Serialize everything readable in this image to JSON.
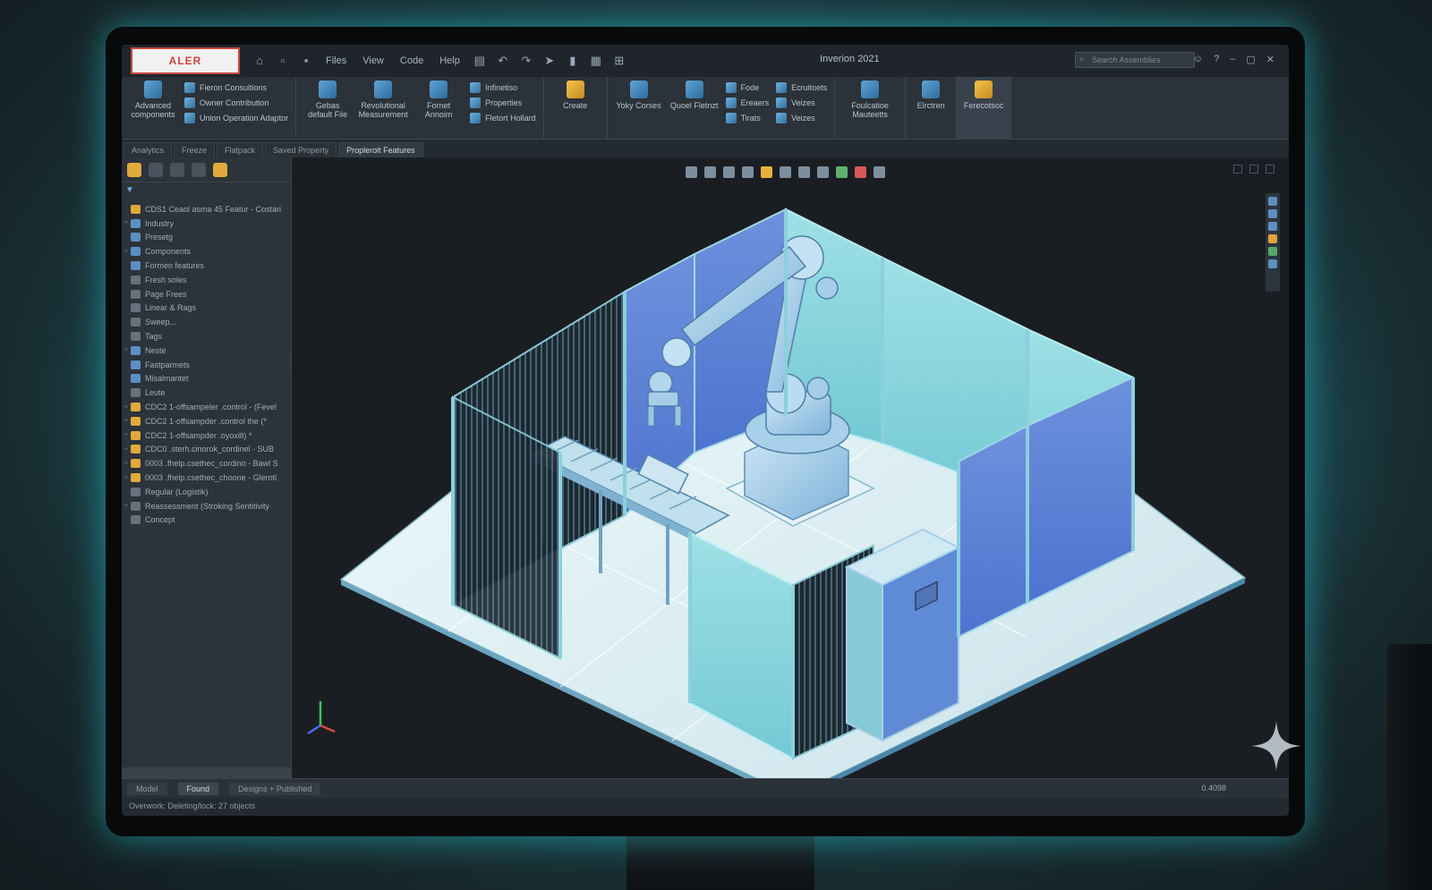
{
  "app": {
    "logo_text": "ALER",
    "window_title": "Inverion 2021",
    "search_placeholder": "Search Assemblies"
  },
  "menu": [
    "Files",
    "View",
    "Code",
    "Help"
  ],
  "ribbon": {
    "group1": [
      {
        "label": "Fieron Consultions"
      },
      {
        "label": "Owner Contribution"
      },
      {
        "label": "Union Operation Adaptor"
      }
    ],
    "group1_big": "Advanced components",
    "group2": [
      {
        "label": "Gebas default File"
      },
      {
        "label": "Revolutional Measurement"
      },
      {
        "label": "Fornet Annoim"
      }
    ],
    "group2_small": [
      "Infinetiso",
      "Properties",
      "Fletort Hollard"
    ],
    "create": "Create",
    "group3_big": [
      "Yoky Corses",
      "Quoel Fletnzt"
    ],
    "group3_small": [
      "Fode",
      "Ereaers",
      "Tirats"
    ],
    "group4_small": [
      "Ecruitoets",
      "Veizes",
      "Veizes"
    ],
    "group5_big": [
      "Foulcatioe Mauteetts",
      "Elrctren",
      "Ferecotsoc"
    ]
  },
  "tabs": [
    "Analytics",
    "Freeze",
    "Flatpack",
    "Saved Property",
    "Proplerolt Features"
  ],
  "active_tab_index": 4,
  "tree": [
    {
      "label": "CDS1 Ceaol asma 45 Featur - Costari",
      "icon": "y",
      "exp": "-"
    },
    {
      "label": "Industry",
      "icon": "b",
      "exp": "+"
    },
    {
      "label": "Presetg",
      "icon": "b",
      "exp": ""
    },
    {
      "label": "Components",
      "icon": "b",
      "exp": "+"
    },
    {
      "label": "Formen features",
      "icon": "b",
      "exp": ""
    },
    {
      "label": "Fresh soles",
      "icon": "g",
      "exp": ""
    },
    {
      "label": "Page Frees",
      "icon": "g",
      "exp": ""
    },
    {
      "label": "Linear & Rags",
      "icon": "g",
      "exp": ""
    },
    {
      "label": "Sweep...",
      "icon": "g",
      "exp": ""
    },
    {
      "label": "Tags",
      "icon": "g",
      "exp": ""
    },
    {
      "label": "Neste",
      "icon": "b",
      "exp": "+"
    },
    {
      "label": "Fastparmets",
      "icon": "b",
      "exp": ""
    },
    {
      "label": "Misalmantet",
      "icon": "b",
      "exp": ""
    },
    {
      "label": "Leute",
      "icon": "g",
      "exp": ""
    },
    {
      "label": "CDC2 1-offsampeler .control - (Fevel",
      "icon": "y",
      "exp": "+"
    },
    {
      "label": "CDC2 1-offsampder .control the (*",
      "icon": "y",
      "exp": "+"
    },
    {
      "label": "CDC2 1-offsampder .oyoxilt) *",
      "icon": "y",
      "exp": "+"
    },
    {
      "label": "CDC0 .sterh.cinorok_cordinel - SUB",
      "icon": "y",
      "exp": "+"
    },
    {
      "label": "0003 .fhelp.csethec_cordino - Bawl S",
      "icon": "y",
      "exp": "+"
    },
    {
      "label": "0003 .fhelp.csethec_choone - Glerotl",
      "icon": "y",
      "exp": "+"
    },
    {
      "label": "Regular (Logistik)",
      "icon": "g",
      "exp": ""
    },
    {
      "label": "Reassessment (Stroking Sentitivity",
      "icon": "g",
      "exp": "+"
    },
    {
      "label": "Concept",
      "icon": "g",
      "exp": ""
    }
  ],
  "bottom_tabs": [
    "Model",
    "Found",
    "Designs + Published"
  ],
  "zoom": "0.4098",
  "status": "Overwork: Deleting/lock: 27 objects",
  "colors": {
    "accent": "#5ea4d6",
    "cell_panel_light": "#8fd3dc",
    "cell_panel_dark": "#5a7fd6",
    "floor": "#dfeef2"
  }
}
